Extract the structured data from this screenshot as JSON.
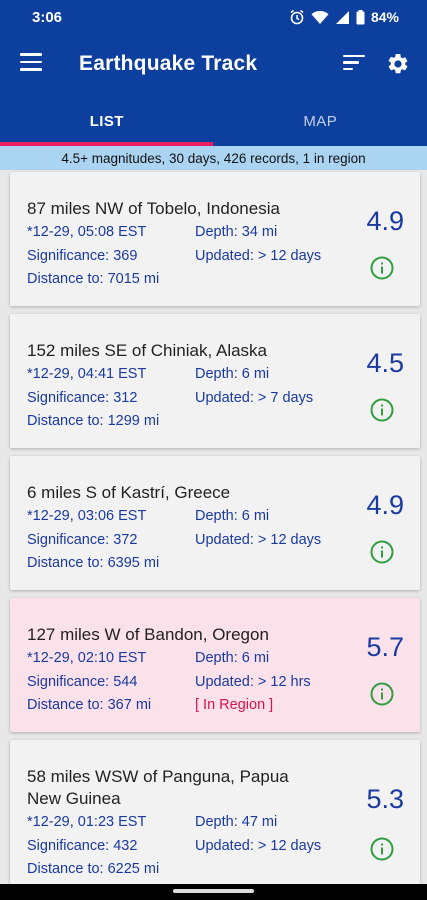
{
  "status": {
    "time": "3:06",
    "battery": "84%"
  },
  "app": {
    "title": "Earthquake Track"
  },
  "tabs": [
    {
      "label": "LIST"
    },
    {
      "label": "MAP"
    }
  ],
  "summary": "4.5+ magnitudes, 30 days, 426 records, 1 in region",
  "colors": {
    "primary": "#0d3f9e",
    "accent": "#e91e63",
    "info": "#2e9e40",
    "region_bg": "#fbe1ea"
  },
  "quakes": [
    {
      "place": "87 miles NW of Tobelo, Indonesia",
      "time": "*12-29, 05:08 EST",
      "depth": "Depth: 34 mi",
      "significance": "Significance: 369",
      "updated": "Updated: > 12 days",
      "distance": "Distance to: 7015 mi",
      "magnitude": "4.9",
      "region": ""
    },
    {
      "place": "152 miles SE of Chiniak, Alaska",
      "time": "*12-29, 04:41 EST",
      "depth": "Depth: 6 mi",
      "significance": "Significance: 312",
      "updated": "Updated: > 7 days",
      "distance": "Distance to: 1299 mi",
      "magnitude": "4.5",
      "region": ""
    },
    {
      "place": "6 miles S of Kastrí, Greece",
      "time": "*12-29, 03:06 EST",
      "depth": "Depth: 6 mi",
      "significance": "Significance: 372",
      "updated": "Updated: > 12 days",
      "distance": "Distance to: 6395 mi",
      "magnitude": "4.9",
      "region": ""
    },
    {
      "place": "127 miles W of Bandon, Oregon",
      "time": "*12-29, 02:10 EST",
      "depth": "Depth: 6 mi",
      "significance": "Significance: 544",
      "updated": "Updated: > 12 hrs",
      "distance": "Distance to: 367 mi",
      "magnitude": "5.7",
      "region": "[ In Region ]"
    },
    {
      "place": "58 miles WSW of Panguna, Papua New Guinea",
      "time": "*12-29, 01:23 EST",
      "depth": "Depth: 47 mi",
      "significance": "Significance: 432",
      "updated": "Updated: > 12 days",
      "distance": "Distance to: 6225 mi",
      "magnitude": "5.3",
      "region": ""
    }
  ]
}
